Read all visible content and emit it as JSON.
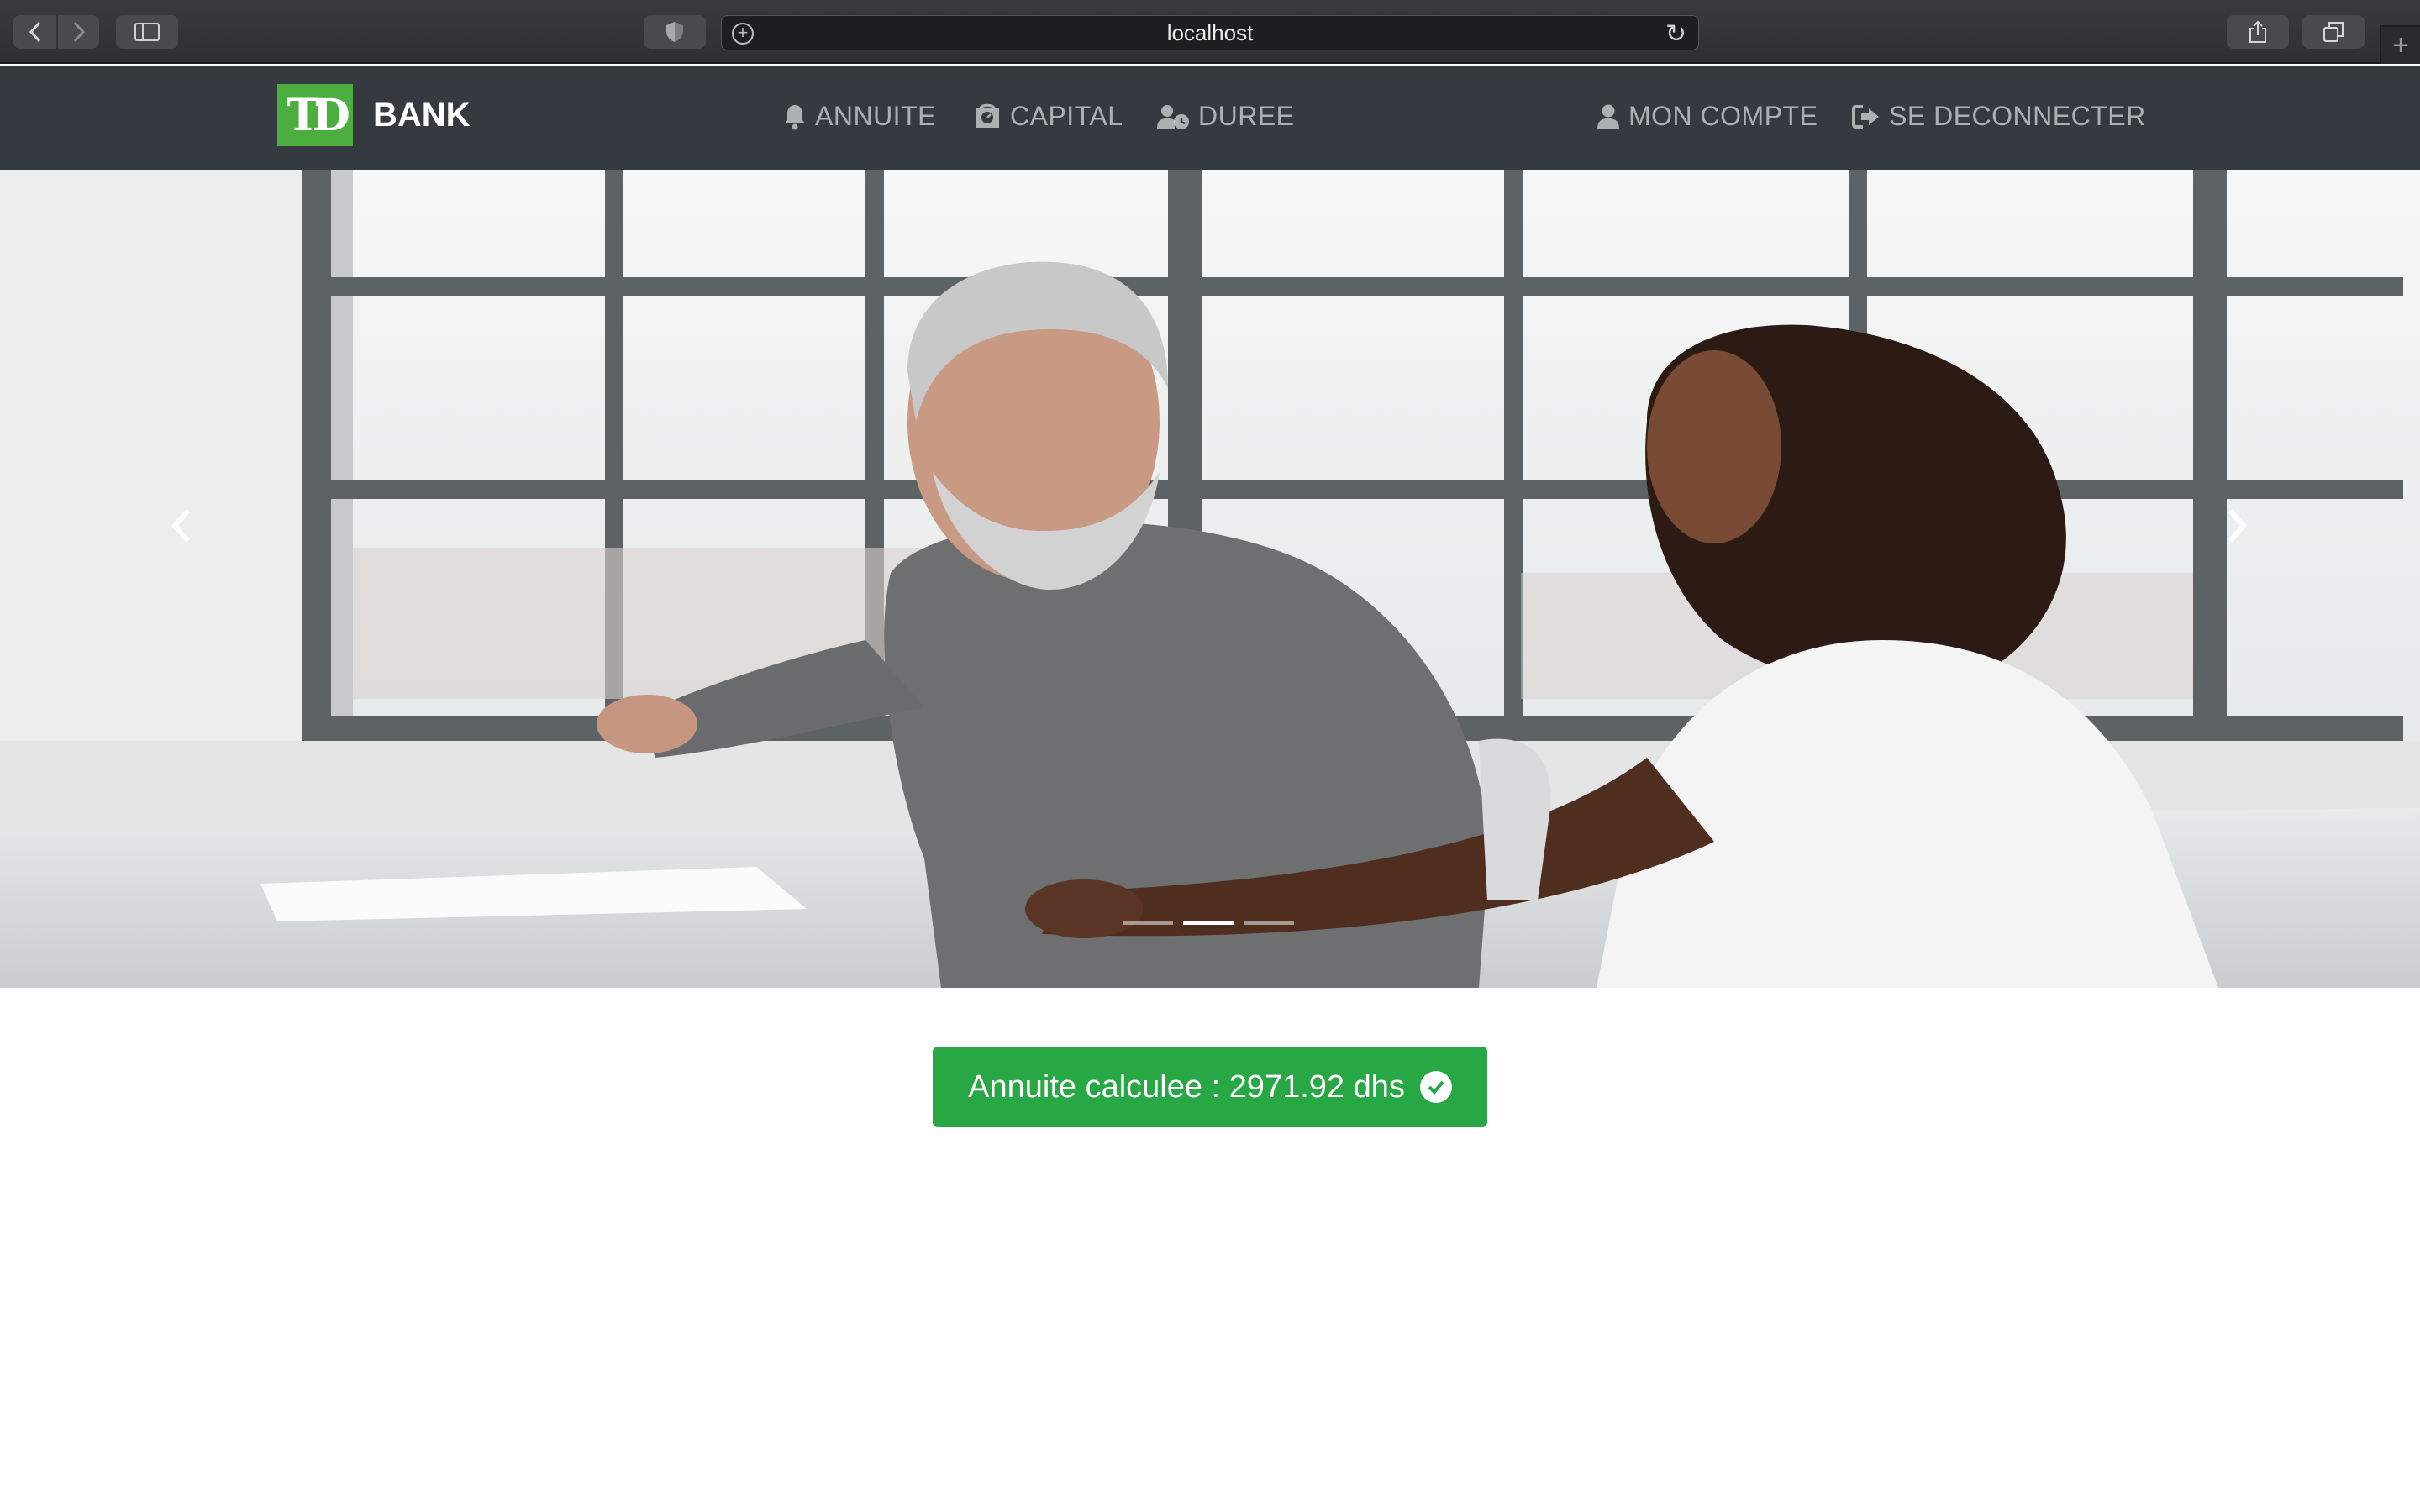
{
  "browser": {
    "url": "localhost"
  },
  "navbar": {
    "brand": "BANK",
    "logo_text": "TD",
    "links": [
      {
        "label": "ANNUITE",
        "icon": "bell-icon"
      },
      {
        "label": "CAPITAL",
        "icon": "calculator-icon"
      },
      {
        "label": "DUREE",
        "icon": "user-clock-icon"
      }
    ],
    "account_label": "MON COMPTE",
    "logout_label": "SE DECONNECTER"
  },
  "carousel": {
    "active_index": 1,
    "slide_count": 3
  },
  "result": {
    "text": "Annuite calculee : 2971.92 dhs",
    "icon": "check-circle-icon"
  },
  "colors": {
    "navbar_bg": "#343a40",
    "brand_green": "#4cae3f",
    "success_green": "#28a745"
  }
}
